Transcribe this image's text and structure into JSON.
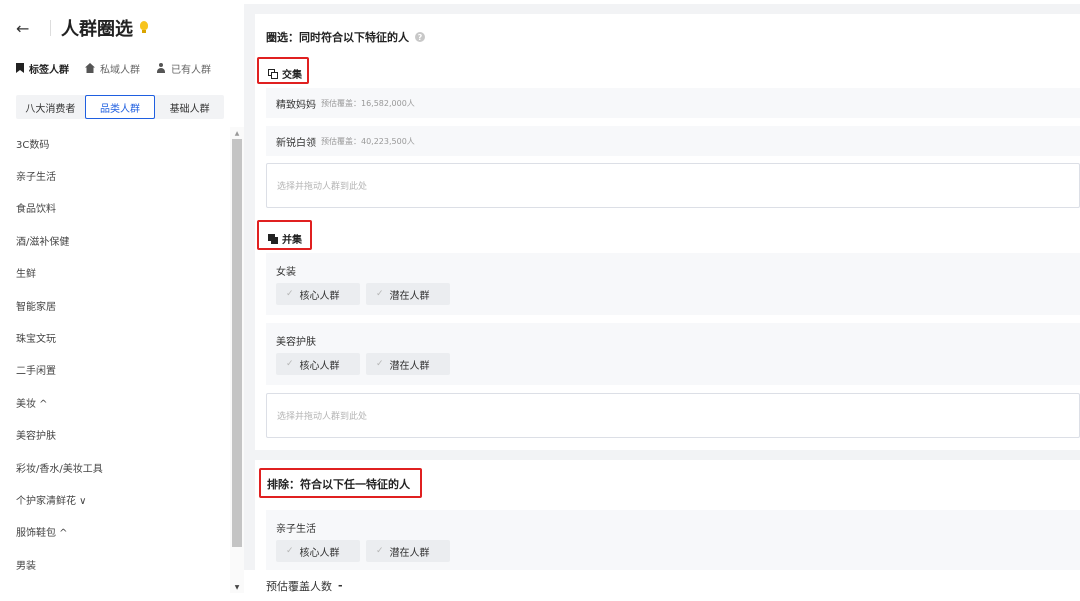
{
  "header": {
    "back_icon": "arrow-left-icon",
    "title": "人群圈选"
  },
  "tabs": [
    {
      "label": "标签人群",
      "icon": "bookmark-icon",
      "active": true
    },
    {
      "label": "私域人群",
      "icon": "shop-icon",
      "active": false
    },
    {
      "label": "已有人群",
      "icon": "user-icon",
      "active": false
    }
  ],
  "segment": [
    {
      "label": "八大消费者",
      "active": false
    },
    {
      "label": "品类人群",
      "active": true
    },
    {
      "label": "基础人群",
      "active": false
    }
  ],
  "categories": [
    "3C数码",
    "亲子生活",
    "食品饮料",
    "酒/滋补保健",
    "生鲜",
    "智能家居",
    "珠宝文玩",
    "二手闲置",
    "美妆 ^",
    "美容护肤",
    "彩妆/香水/美妆工具",
    "个护家清鲜花 ∨",
    "服饰鞋包 ^",
    "男装"
  ],
  "main": {
    "select_title": "圈选：同时符合以下特征的人",
    "intersection": {
      "label": "交集",
      "rows": [
        {
          "name": "精致妈妈",
          "estimate": "预估覆盖：16,582,000人"
        },
        {
          "name": "新锐白领",
          "estimate": "预估覆盖：40,223,500人"
        }
      ],
      "drop_placeholder": "选择并拖动人群到此处"
    },
    "union": {
      "label": "并集",
      "groups": [
        {
          "name": "女装",
          "chips": [
            "核心人群",
            "潜在人群"
          ]
        },
        {
          "name": "美容护肤",
          "chips": [
            "核心人群",
            "潜在人群"
          ]
        }
      ],
      "drop_placeholder": "选择并拖动人群到此处"
    },
    "exclude": {
      "title": "排除：符合以下任一特征的人",
      "groups": [
        {
          "name": "亲子生活",
          "chips": [
            "核心人群",
            "潜在人群"
          ]
        }
      ]
    }
  },
  "footer": {
    "label": "预估覆盖人数",
    "value": "-"
  }
}
